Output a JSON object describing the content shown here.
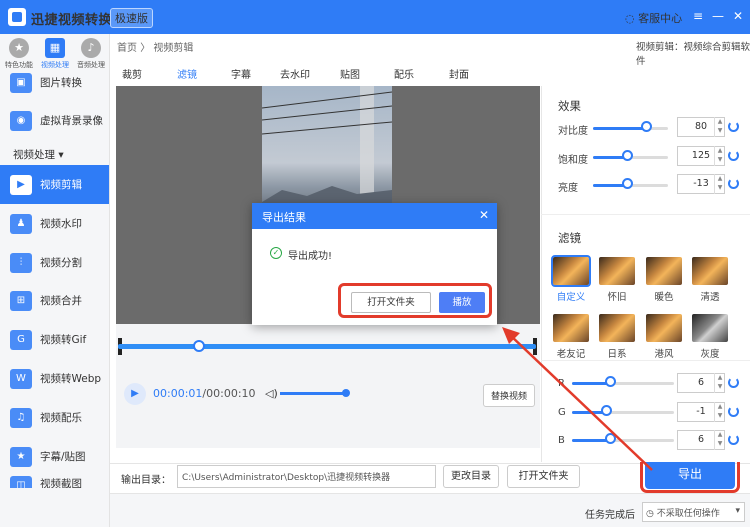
{
  "app": {
    "title": "迅捷视频转换器",
    "edition": "极速版",
    "support": "客服中心"
  },
  "top_categories": [
    {
      "label": "特色功能",
      "icon": "star-icon"
    },
    {
      "label": "视频处理",
      "icon": "film-icon"
    },
    {
      "label": "音频处理",
      "icon": "audio-icon"
    }
  ],
  "sidebar": {
    "section": "视频处理",
    "items": [
      {
        "label": "图片转换",
        "icon": "image-convert-icon"
      },
      {
        "label": "虚拟背景录像",
        "icon": "virtual-bg-icon"
      },
      {
        "label": "视频剪辑",
        "icon": "video-edit-icon"
      },
      {
        "label": "视频水印",
        "icon": "watermark-icon"
      },
      {
        "label": "视频分割",
        "icon": "split-icon"
      },
      {
        "label": "视频合并",
        "icon": "merge-icon"
      },
      {
        "label": "视频转Gif",
        "icon": "gif-icon"
      },
      {
        "label": "视频转Webp",
        "icon": "webp-icon"
      },
      {
        "label": "视频配乐",
        "icon": "music-icon"
      },
      {
        "label": "字幕/贴图",
        "icon": "subtitle-icon"
      },
      {
        "label": "视频截图",
        "icon": "screenshot-icon"
      }
    ]
  },
  "breadcrumb": {
    "home": "首页",
    "sep": "〉",
    "current": "视频剪辑"
  },
  "crumb_right": "视频剪辑：视频综合剪辑软件",
  "tabs": [
    "裁剪",
    "滤镜",
    "字幕",
    "去水印",
    "贴图",
    "配乐",
    "封面"
  ],
  "player": {
    "current": "00:00:01",
    "total": "/00:00:10",
    "replace": "替换视频"
  },
  "output": {
    "label": "输出目录：",
    "path": "C:\\Users\\Administrator\\Desktop\\迅捷视频转换器",
    "change": "更改目录",
    "open": "打开文件夹",
    "export": "导出"
  },
  "status": {
    "label": "任务完成后",
    "option": "不采取任何操作"
  },
  "effects": {
    "title": "效果",
    "items": [
      {
        "label": "对比度",
        "value": "80",
        "level": 0.7
      },
      {
        "label": "饱和度",
        "value": "125",
        "level": 0.45
      },
      {
        "label": "亮度",
        "value": "-13",
        "level": 0.45
      }
    ]
  },
  "filters": {
    "title": "滤镜",
    "items": [
      "自定义",
      "怀旧",
      "暖色",
      "清透",
      "老友记",
      "日系",
      "港风",
      "灰度"
    ]
  },
  "rgb": [
    {
      "label": "R",
      "value": "6",
      "level": 0.37
    },
    {
      "label": "G",
      "value": "-1",
      "level": 0.33
    },
    {
      "label": "B",
      "value": "6",
      "level": 0.37
    }
  ],
  "dialog": {
    "title": "导出结果",
    "message": "导出成功!",
    "open": "打开文件夹",
    "play": "播放"
  },
  "colors": {
    "accent": "#2f7cf6",
    "highlight": "#e23b2b"
  }
}
